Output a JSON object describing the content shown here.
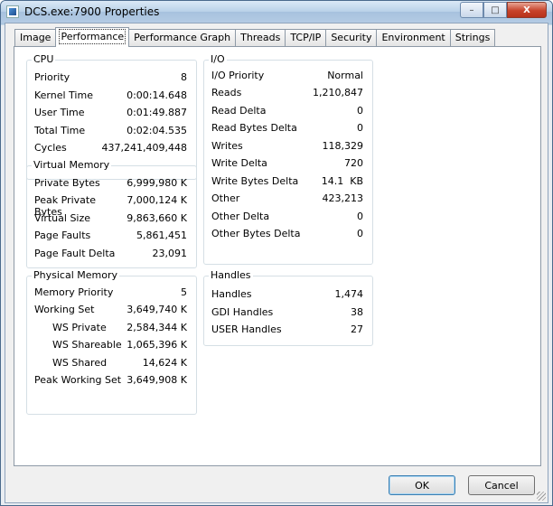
{
  "window": {
    "title": "DCS.exe:7900 Properties",
    "minimize_symbol": "–",
    "maximize_symbol": "□",
    "close_symbol": "X"
  },
  "tabs": [
    "Image",
    "Performance",
    "Performance Graph",
    "Threads",
    "TCP/IP",
    "Security",
    "Environment",
    "Strings"
  ],
  "selected_tab": "Performance",
  "cpu": {
    "title": "CPU",
    "rows": [
      {
        "label": "Priority",
        "value": "8"
      },
      {
        "label": "Kernel Time",
        "value": "0:00:14.648"
      },
      {
        "label": "User Time",
        "value": "0:01:49.887"
      },
      {
        "label": "Total Time",
        "value": "0:02:04.535"
      },
      {
        "label": "Cycles",
        "value": "437,241,409,448"
      }
    ]
  },
  "virtual_memory": {
    "title": "Virtual Memory",
    "rows": [
      {
        "label": "Private Bytes",
        "value": "6,999,980 K"
      },
      {
        "label": "Peak Private Bytes",
        "value": "7,000,124 K"
      },
      {
        "label": "Virtual Size",
        "value": "9,863,660 K"
      },
      {
        "label": "Page Faults",
        "value": "5,861,451"
      },
      {
        "label": "Page Fault Delta",
        "value": "23,091"
      }
    ]
  },
  "physical_memory": {
    "title": "Physical Memory",
    "rows": [
      {
        "label": "Memory Priority",
        "value": "5"
      },
      {
        "label": "Working Set",
        "value": "3,649,740 K"
      },
      {
        "label": "WS Private",
        "value": "2,584,344 K"
      },
      {
        "label": "WS Shareable",
        "value": "1,065,396 K"
      },
      {
        "label": "WS Shared",
        "value": "14,624 K"
      },
      {
        "label": "Peak Working Set",
        "value": "3,649,908 K"
      }
    ]
  },
  "io": {
    "title": "I/O",
    "rows": [
      {
        "label": "I/O Priority",
        "value": "Normal"
      },
      {
        "label": "Reads",
        "value": "1,210,847"
      },
      {
        "label": "Read Delta",
        "value": "0"
      },
      {
        "label": "Read Bytes Delta",
        "value": "0"
      },
      {
        "label": "Writes",
        "value": "118,329"
      },
      {
        "label": "Write Delta",
        "value": "720"
      },
      {
        "label": "Write Bytes Delta",
        "value": "14.1  KB"
      },
      {
        "label": "Other",
        "value": "423,213"
      },
      {
        "label": "Other Delta",
        "value": "0"
      },
      {
        "label": "Other Bytes Delta",
        "value": "0"
      }
    ]
  },
  "handles": {
    "title": "Handles",
    "rows": [
      {
        "label": "Handles",
        "value": "1,474"
      },
      {
        "label": "GDI Handles",
        "value": "38"
      },
      {
        "label": "USER Handles",
        "value": "27"
      }
    ]
  },
  "buttons": {
    "ok": "OK",
    "cancel": "Cancel"
  }
}
